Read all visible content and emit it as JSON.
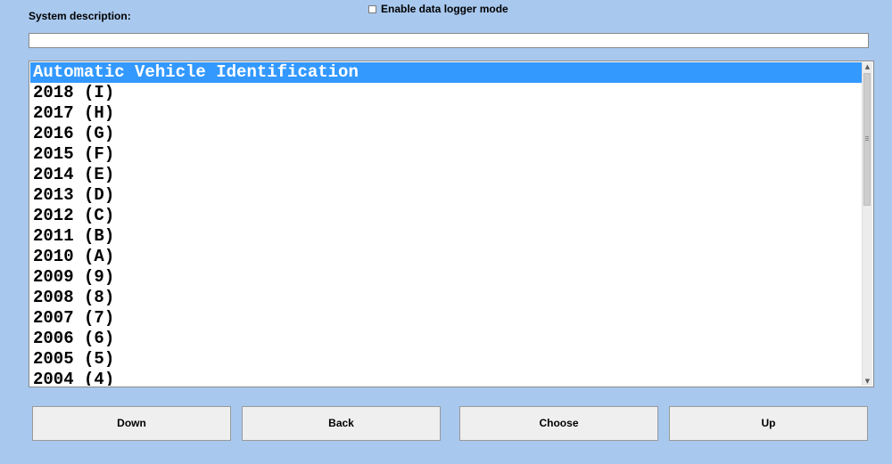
{
  "header": {
    "system_description_label": "System description:",
    "system_description_value": "",
    "data_logger_label": "Enable data logger mode",
    "data_logger_checked": false
  },
  "list": {
    "selected_index": 0,
    "items": [
      {
        "label": "Automatic Vehicle Identification"
      },
      {
        "label": "2018 (I)"
      },
      {
        "label": "2017 (H)"
      },
      {
        "label": "2016 (G)"
      },
      {
        "label": "2015 (F)"
      },
      {
        "label": "2014 (E)"
      },
      {
        "label": "2013 (D)"
      },
      {
        "label": "2012 (C)"
      },
      {
        "label": "2011 (B)"
      },
      {
        "label": "2010 (A)"
      },
      {
        "label": "2009 (9)"
      },
      {
        "label": "2008 (8)"
      },
      {
        "label": "2007 (7)"
      },
      {
        "label": "2006 (6)"
      },
      {
        "label": "2005 (5)"
      },
      {
        "label": "2004 (4)"
      }
    ]
  },
  "buttons": {
    "down": "Down",
    "back": "Back",
    "choose": "Choose",
    "up": "Up"
  },
  "colors": {
    "background": "#a8c8ee",
    "selection": "#3399ff",
    "button_face": "#efefef"
  }
}
